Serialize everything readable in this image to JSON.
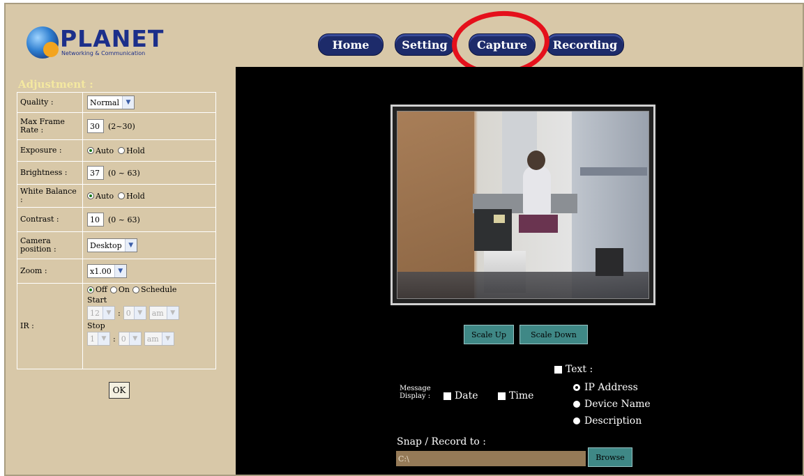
{
  "header": {
    "brand": "PLANET",
    "tagline": "Networking & Communication",
    "nav": [
      "Home",
      "Setting",
      "Capture",
      "Recording"
    ]
  },
  "adjustment": {
    "title": "Adjustment :",
    "quality": {
      "label": "Quality :",
      "value": "Normal"
    },
    "frame_rate": {
      "label": "Max Frame Rate :",
      "value": "30",
      "range": "(2~30)"
    },
    "exposure": {
      "label": "Exposure :",
      "options": [
        "Auto",
        "Hold"
      ],
      "selected": "Auto"
    },
    "brightness": {
      "label": "Brightness :",
      "value": "37",
      "range": "(0 ~ 63)"
    },
    "white_balance": {
      "label": "White Balance :",
      "options": [
        "Auto",
        "Hold"
      ],
      "selected": "Auto"
    },
    "contrast": {
      "label": "Contrast :",
      "value": "10",
      "range": "(0 ~ 63)"
    },
    "camera_position": {
      "label": "Camera position :",
      "value": "Desktop"
    },
    "zoom": {
      "label": "Zoom :",
      "value": "x1.00"
    },
    "ir": {
      "label": "IR :",
      "options": [
        "Off",
        "On",
        "Schedule"
      ],
      "selected": "Off",
      "start_label": "Start",
      "start": {
        "hour": "12",
        "min": "0",
        "ampm": "am"
      },
      "stop_label": "Stop",
      "stop": {
        "hour": "1",
        "min": "0",
        "ampm": "am"
      },
      "sep": ":"
    },
    "ok_label": "OK"
  },
  "main": {
    "scale_up": "Scale Up",
    "scale_down": "Scale Down",
    "message_display": "Message Display :",
    "date_label": "Date",
    "time_label": "Time",
    "text_label": "Text :",
    "text_options": [
      "IP Address",
      "Device Name",
      "Description"
    ],
    "text_selected": "IP Address",
    "snap_label": "Snap / Record to :",
    "path": "C:\\",
    "browse_label": "Browse"
  },
  "colors": {
    "background": "#d8c8a8",
    "nav_button": "#1d2b6a",
    "highlight_circle": "#e5101b",
    "teal_button": "#3f8886",
    "path_field": "#957a57"
  }
}
